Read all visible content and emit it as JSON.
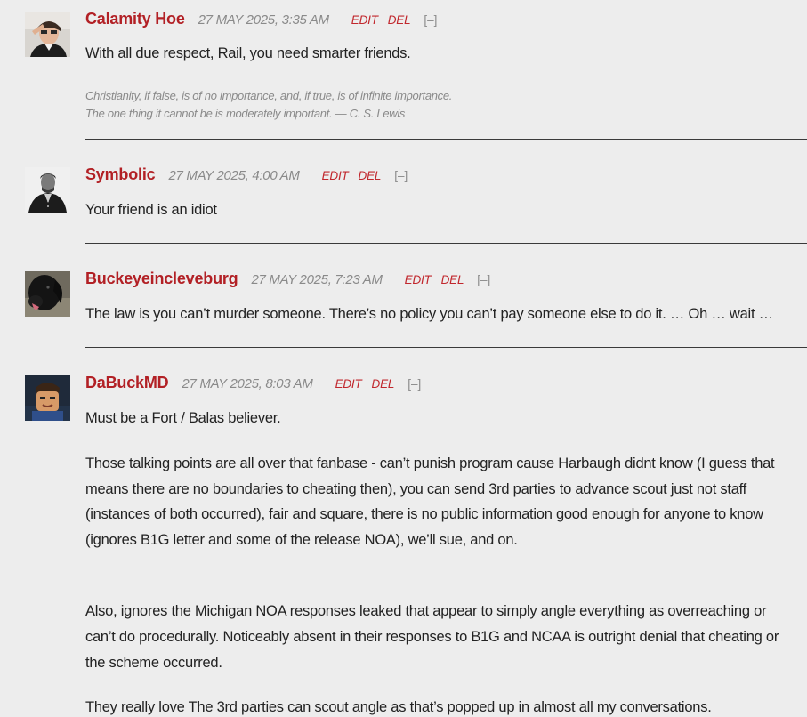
{
  "comments": [
    {
      "author": "Calamity Hoe",
      "timestamp": "27 MAY 2025, 3:35 AM",
      "edit_label": "EDIT",
      "del_label": "DEL",
      "collapse_label": "[–]",
      "body": [
        "With all due respect, Rail, you need smarter friends."
      ],
      "signature": [
        "Christianity, if false, is of no importance, and, if true, is of infinite importance.",
        "The one thing it cannot be is moderately important. — C. S. Lewis"
      ]
    },
    {
      "author": "Symbolic",
      "timestamp": "27 MAY 2025, 4:00 AM",
      "edit_label": "EDIT",
      "del_label": "DEL",
      "collapse_label": "[–]",
      "body": [
        "Your friend is an idiot"
      ]
    },
    {
      "author": "Buckeyeincleveburg",
      "timestamp": "27 MAY 2025, 7:23 AM",
      "edit_label": "EDIT",
      "del_label": "DEL",
      "collapse_label": "[–]",
      "body": [
        "The law is you can’t murder someone. There’s no policy you can’t pay someone else to do it. … Oh … wait …"
      ]
    },
    {
      "author": "DaBuckMD",
      "timestamp": "27 MAY 2025, 8:03 AM",
      "edit_label": "EDIT",
      "del_label": "DEL",
      "collapse_label": "[–]",
      "body": [
        "Must be a Fort / Balas believer.",
        "Those talking points are all over that fanbase - can’t punish program cause Harbaugh didnt know (I guess that means there are no boundaries to cheating then), you can send 3rd parties to advance scout just not staff (instances of both occurred), fair and square, there is no public information good enough for anyone to know (ignores B1G letter and some of the release NOA), we’ll sue, and on.",
        "Also, ignores the Michigan NOA responses leaked that appear to simply angle everything as overreaching or can’t do procedurally.  Noticeably absent in their responses to B1G and NCAA is outright denial that cheating or the scheme occurred.",
        "They really love The 3rd parties can scout angle as that’s popped up in almost all my conversations."
      ]
    }
  ],
  "icons": {
    "avatar_1": "avatar-saluting-man-icon",
    "avatar_2": "avatar-general-portrait-icon",
    "avatar_3": "avatar-black-dog-icon",
    "avatar_4": "avatar-cartoon-face-icon"
  },
  "colors": {
    "background": "#ededed",
    "author": "#b22025",
    "action_link": "#c1272d",
    "muted": "#8a8a8a",
    "text": "#222222",
    "divider": "#3a3a3a"
  }
}
